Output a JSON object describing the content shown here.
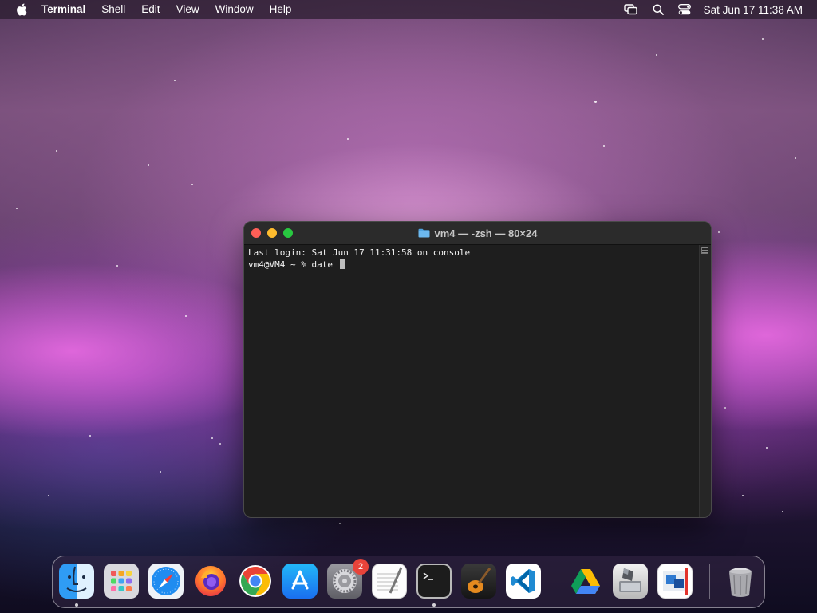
{
  "menubar": {
    "app_name": "Terminal",
    "menus": [
      "Shell",
      "Edit",
      "View",
      "Window",
      "Help"
    ],
    "right_icons": [
      "screen-mirroring-icon",
      "spotlight-search-icon",
      "control-center-icon"
    ],
    "clock": "Sat Jun 17  11:38 AM"
  },
  "terminal": {
    "title": "vm4 — -zsh — 80×24",
    "lines": [
      "Last login: Sat Jun 17 11:31:58 on console",
      "vm4@VM4 ~ % date "
    ]
  },
  "dock": {
    "apps": [
      {
        "name": "Finder",
        "icon": "finder-icon",
        "running": true
      },
      {
        "name": "Launchpad",
        "icon": "launchpad-icon",
        "running": false
      },
      {
        "name": "Safari",
        "icon": "safari-icon",
        "running": false
      },
      {
        "name": "Firefox",
        "icon": "firefox-icon",
        "running": false
      },
      {
        "name": "Google Chrome",
        "icon": "chrome-icon",
        "running": false
      },
      {
        "name": "App Store",
        "icon": "app-store-icon",
        "running": false
      },
      {
        "name": "System Preferences",
        "icon": "system-preferences-icon",
        "running": false,
        "badge": "2"
      },
      {
        "name": "TextEdit",
        "icon": "textedit-icon",
        "running": false
      },
      {
        "name": "Terminal",
        "icon": "terminal-icon",
        "running": true
      },
      {
        "name": "GarageBand",
        "icon": "garageband-icon",
        "running": false
      },
      {
        "name": "Visual Studio Code",
        "icon": "vscode-icon",
        "running": false
      },
      {
        "name": "Google Drive",
        "icon": "google-drive-icon",
        "running": false
      },
      {
        "name": "Boot Camp Assistant",
        "icon": "bootcamp-icon",
        "running": false
      },
      {
        "name": "Parallels Desktop",
        "icon": "parallels-icon",
        "running": false
      },
      {
        "name": "Trash",
        "icon": "trash-icon",
        "running": false
      }
    ]
  },
  "colors": {
    "terminal_bg": "#1e1e1e",
    "close": "#fe5f57",
    "minimize": "#febc2e",
    "zoom": "#28c840",
    "badge": "#e8433a"
  }
}
